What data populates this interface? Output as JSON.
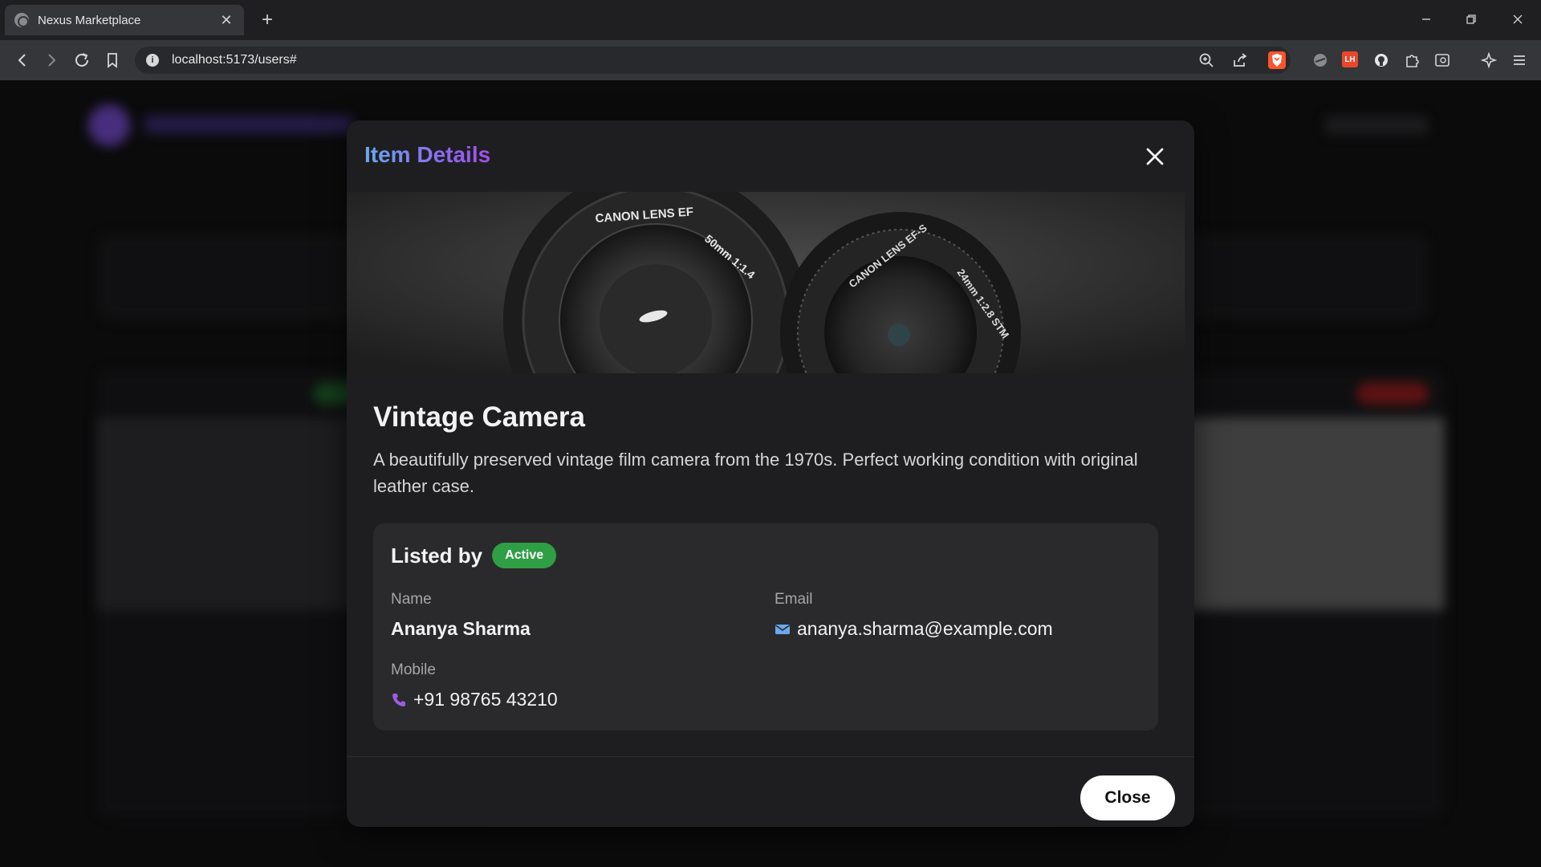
{
  "browser": {
    "tab_title": "Nexus Marketplace",
    "url": "localhost:5173/users#",
    "tab_close": "✕",
    "new_tab": "+",
    "extensions": {
      "lighthouse": "LH"
    }
  },
  "modal": {
    "title": "Item Details",
    "item": {
      "name": "Vintage Camera",
      "description": "A beautifully preserved vintage film camera from the 1970s. Perfect working condition with original leather case.",
      "hero_lens_text_left": "CANON LENS EF 50mm 1:1.4",
      "hero_lens_text_right": "CANON LENS EF-S 24mm 1:2.8 STM"
    },
    "owner": {
      "heading": "Listed by",
      "status": "Active",
      "name_label": "Name",
      "name": "Ananya Sharma",
      "email_label": "Email",
      "email": "ananya.sharma@example.com",
      "mobile_label": "Mobile",
      "mobile": "+91 98765 43210"
    },
    "close_label": "Close"
  },
  "colors": {
    "badge_active": "#2f9e44",
    "title_gradient_start": "#6aa8ee",
    "title_gradient_end": "#a24fe6",
    "email_icon": "#6aa8ee",
    "phone_icon": "#9b5de5"
  }
}
